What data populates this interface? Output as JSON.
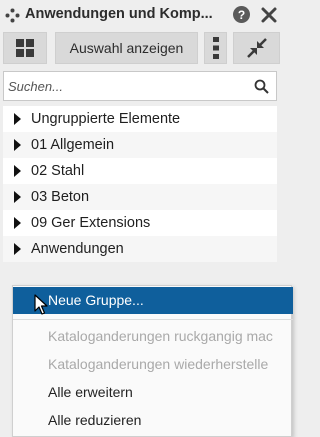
{
  "panel": {
    "title": "Anwendungen und Komp...",
    "help_label": "?"
  },
  "toolbar": {
    "show_selection_label": "Auswahl anzeigen"
  },
  "search": {
    "placeholder": "Suchen..."
  },
  "tree": {
    "items": [
      {
        "label": "Ungruppierte Elemente"
      },
      {
        "label": "01 Allgemein"
      },
      {
        "label": "02 Stahl"
      },
      {
        "label": "03 Beton"
      },
      {
        "label": "09 Ger Extensions"
      },
      {
        "label": "Anwendungen"
      }
    ]
  },
  "context_menu": {
    "items": [
      {
        "label": "Neue Gruppe...",
        "state": "highlighted"
      },
      {
        "label": "Kataloganderungen ruckgangig mac",
        "state": "disabled"
      },
      {
        "label": "Kataloganderungen wiederherstelle",
        "state": "disabled"
      },
      {
        "label": "Alle erweitern",
        "state": "enabled"
      },
      {
        "label": "Alle reduzieren",
        "state": "enabled"
      }
    ]
  },
  "colors": {
    "highlight": "#0f5f9c",
    "disabled_text": "#a9a9a9",
    "panel_bg": "#eeeeee"
  }
}
